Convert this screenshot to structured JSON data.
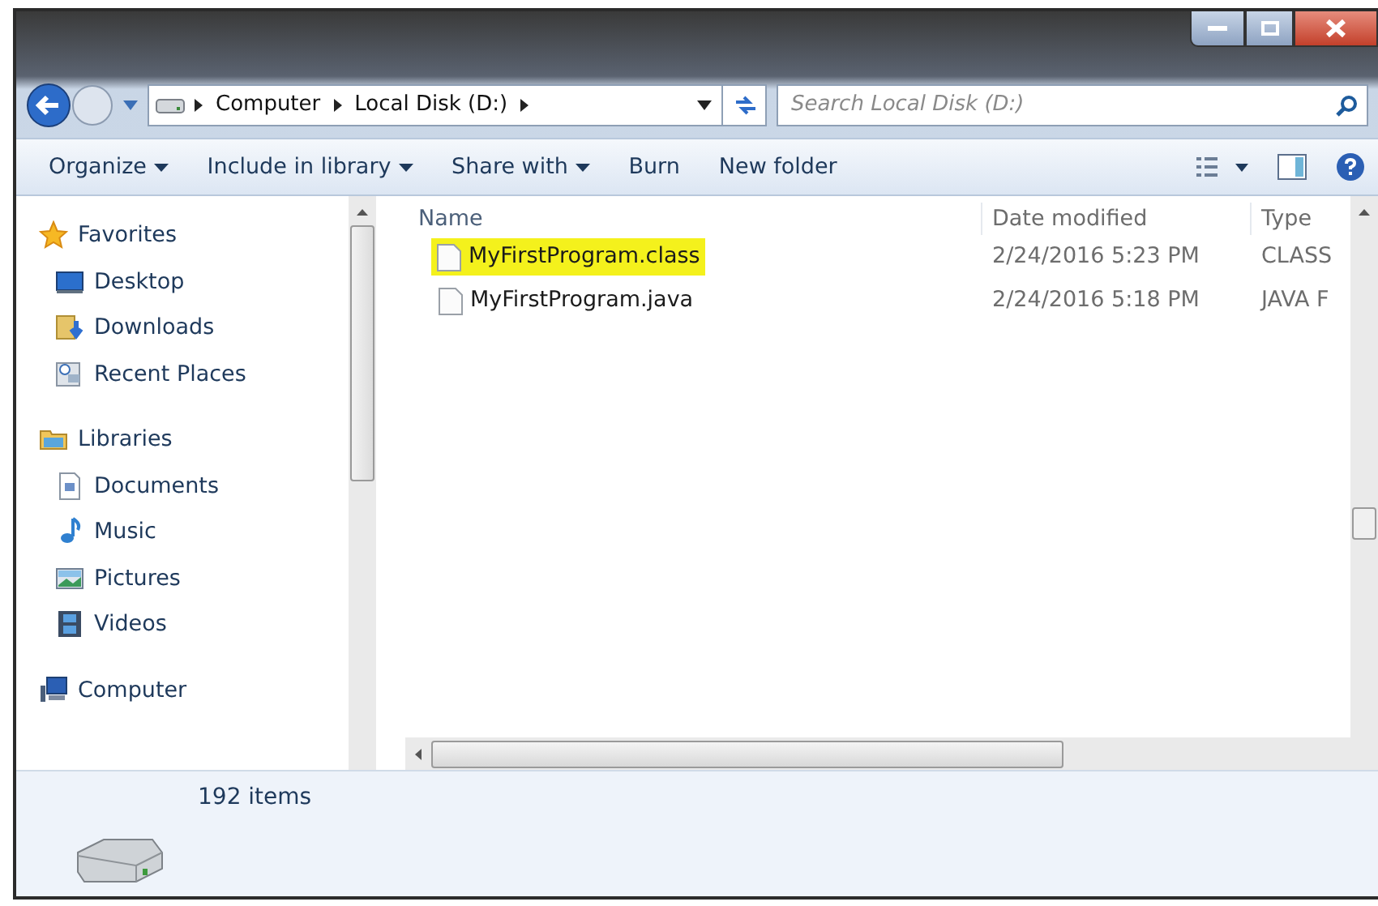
{
  "address_bar": {
    "crumbs": [
      "Computer",
      "Local Disk (D:)"
    ]
  },
  "search": {
    "placeholder": "Search Local Disk (D:)"
  },
  "toolbar": [
    {
      "label": "Organize",
      "dropdown": true
    },
    {
      "label": "Include in library",
      "dropdown": true
    },
    {
      "label": "Share with",
      "dropdown": true
    },
    {
      "label": "Burn",
      "dropdown": false
    },
    {
      "label": "New folder",
      "dropdown": false
    }
  ],
  "navigation": [
    {
      "label": "Favorites",
      "kind": "star",
      "children": [
        {
          "label": "Desktop",
          "kind": "desktop"
        },
        {
          "label": "Downloads",
          "kind": "downloads"
        },
        {
          "label": "Recent Places",
          "kind": "recent"
        }
      ]
    },
    {
      "label": "Libraries",
      "kind": "library",
      "children": [
        {
          "label": "Documents",
          "kind": "documents"
        },
        {
          "label": "Music",
          "kind": "music"
        },
        {
          "label": "Pictures",
          "kind": "pictures"
        },
        {
          "label": "Videos",
          "kind": "videos"
        }
      ]
    },
    {
      "label": "Computer",
      "kind": "computer"
    }
  ],
  "table": {
    "columns": [
      "Name",
      "Date modified",
      "Type"
    ],
    "rows": [
      {
        "name": "MyFirstProgram.class",
        "date": "2/24/2016 5:23 PM",
        "type": "CLASS",
        "highlighted": true
      },
      {
        "name": "MyFirstProgram.java",
        "date": "2/24/2016 5:18 PM",
        "type": "JAVA F",
        "highlighted": false
      }
    ]
  },
  "status_bar": {
    "text": "192 items"
  }
}
